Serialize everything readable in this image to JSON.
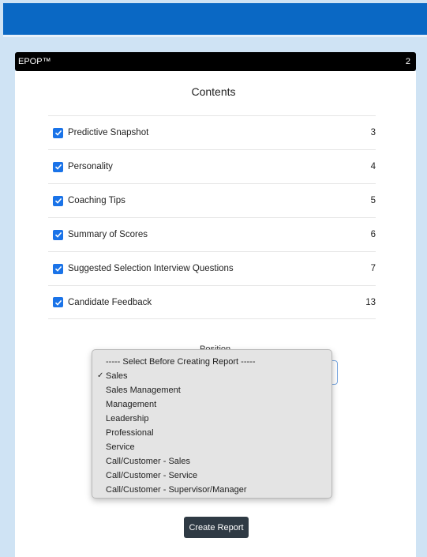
{
  "header": {
    "title": "EPOP™",
    "page_number": "2"
  },
  "contents": {
    "title": "Contents",
    "items": [
      {
        "label": "Predictive Snapshot",
        "page": "3"
      },
      {
        "label": "Personality",
        "page": "4"
      },
      {
        "label": "Coaching Tips",
        "page": "5"
      },
      {
        "label": "Summary of Scores",
        "page": "6"
      },
      {
        "label": "Suggested Selection Interview Questions",
        "page": "7"
      },
      {
        "label": "Candidate Feedback",
        "page": "13"
      }
    ]
  },
  "position": {
    "label": "Position",
    "options": [
      "----- Select Before Creating Report -----",
      "Sales",
      "Sales Management",
      "Management",
      "Leadership",
      "Professional",
      "Service",
      "Call/Customer - Sales",
      "Call/Customer - Service",
      "Call/Customer - Supervisor/Manager"
    ],
    "selected_check": "✓"
  },
  "actions": {
    "create_report": "Create Report"
  },
  "colors": {
    "top_band": "#0a68c4",
    "checkbox": "#1a73e8",
    "button": "#2f3a44"
  }
}
